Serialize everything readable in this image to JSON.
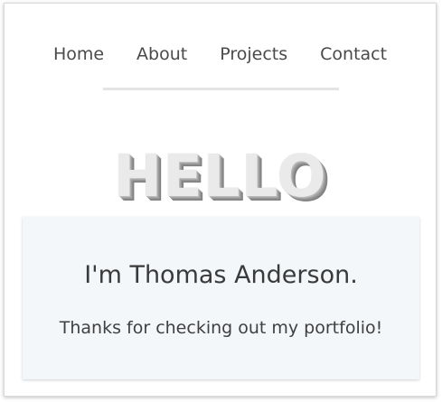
{
  "nav": {
    "items": [
      {
        "label": "Home"
      },
      {
        "label": "About"
      },
      {
        "label": "Projects"
      },
      {
        "label": "Contact"
      }
    ]
  },
  "hero": {
    "greeting": "HELLO"
  },
  "intro": {
    "title": "I'm Thomas Anderson.",
    "subtitle": "Thanks for checking out my portfolio!"
  },
  "colors": {
    "card_background": "#f4f7fa",
    "text": "#333333",
    "divider": "#e4e4e4"
  }
}
